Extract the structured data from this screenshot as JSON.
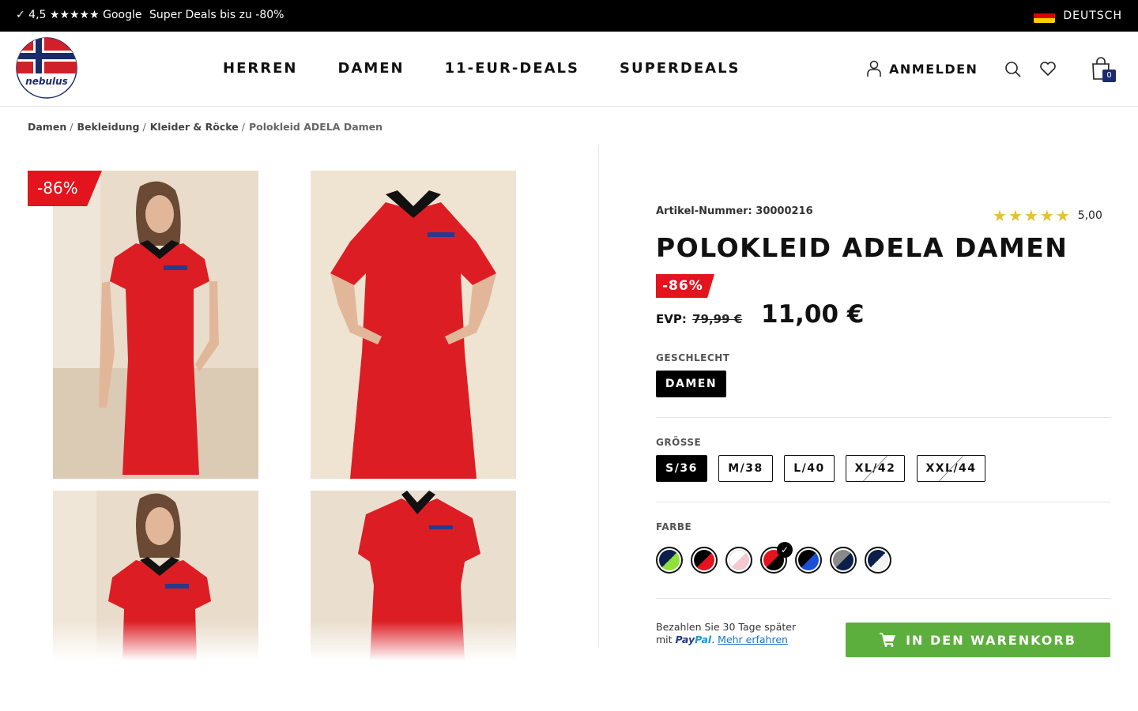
{
  "topbar": {
    "rating": "✓ 4,5 ★★★★★ Google",
    "deals": "Super Deals bis zu -80%",
    "language": "DEUTSCH"
  },
  "header": {
    "logo_text": "nebulus",
    "nav": [
      "HERREN",
      "DAMEN",
      "11-EUR-DEALS",
      "SUPERDEALS"
    ],
    "login": "ANMELDEN",
    "cart_count": "0"
  },
  "breadcrumb": {
    "items": [
      "Damen",
      "Bekleidung",
      "Kleider & Röcke"
    ],
    "current": "Polokleid ADELA Damen"
  },
  "gallery": {
    "discount_badge": "-86%"
  },
  "product": {
    "article_number": "Artikel-Nummer: 30000216",
    "rating_value": 5,
    "rating_label": "5,00",
    "title": "POLOKLEID ADELA DAMEN",
    "discount": "-86%",
    "evp_label": "EVP:",
    "old_price": "79,99 €",
    "price": "11,00 €",
    "gender_label": "GESCHLECHT",
    "gender_options": [
      {
        "label": "DAMEN",
        "selected": true
      }
    ],
    "size_label": "GRÖSSE",
    "sizes": [
      {
        "label": "S/36",
        "selected": true,
        "available": true
      },
      {
        "label": "M/38",
        "selected": false,
        "available": true
      },
      {
        "label": "L/40",
        "selected": false,
        "available": true
      },
      {
        "label": "XL/42",
        "selected": false,
        "available": false
      },
      {
        "label": "XXL/44",
        "selected": false,
        "available": false
      }
    ],
    "color_label": "FARBE",
    "colors": [
      {
        "primary": "#0b1f4a",
        "secondary": "#8fe03a",
        "selected": false
      },
      {
        "primary": "#000000",
        "secondary": "#e3141d",
        "selected": false
      },
      {
        "primary": "#ffffff",
        "secondary": "#f3c9cf",
        "selected": false
      },
      {
        "primary": "#e3141d",
        "secondary": "#000000",
        "selected": true
      },
      {
        "primary": "#000000",
        "secondary": "#1b4fd8",
        "selected": false
      },
      {
        "primary": "#8a8a8a",
        "secondary": "#0b1f4a",
        "selected": false
      },
      {
        "primary": "#0b1f4a",
        "secondary": "#f2f2f2",
        "selected": false
      }
    ],
    "paypal_line1": "Bezahlen Sie 30 Tage später",
    "paypal_mit": "mit",
    "paypal_brand_1": "Pay",
    "paypal_brand_2": "Pal",
    "paypal_link": "Mehr erfahren",
    "add_to_cart": "IN DEN WARENKORB"
  },
  "colors": {
    "accent_red": "#e3141d",
    "cart_green": "#5caf3c",
    "star_gold": "#e6c12f"
  }
}
